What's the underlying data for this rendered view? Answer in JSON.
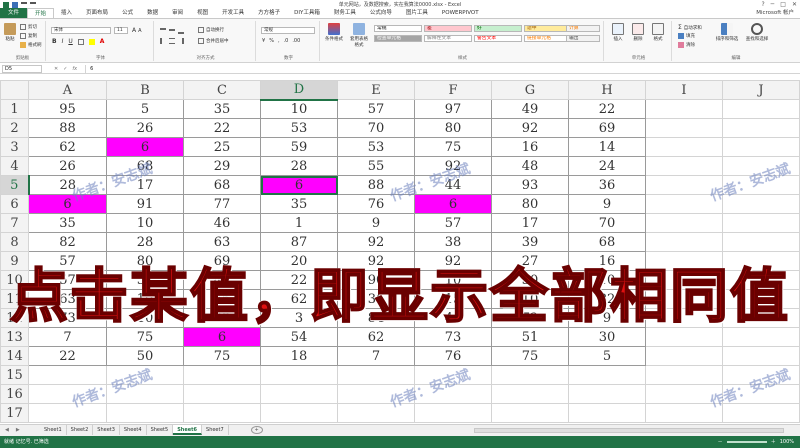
{
  "window": {
    "title": "单元网站，及数据搜索，实在我算法0000.xlsx - Excel",
    "user": "Microsoft 帐户"
  },
  "tabs": [
    "文件",
    "开始",
    "插入",
    "页面布局",
    "公式",
    "数据",
    "审阅",
    "视图",
    "开发工具",
    "方方格子",
    "DIY工具箱",
    "财务工具",
    "公式向导",
    "图片工具",
    "POWERPIVOT"
  ],
  "ribbon": {
    "clipboard_label": "剪贴板",
    "paste": "粘贴",
    "cut": "剪切",
    "copy": "复制",
    "format_painter": "格式刷",
    "font_label": "字体",
    "font_name": "宋体",
    "font_size": "11",
    "align_label": "对齐方式",
    "wrap": "自动换行",
    "merge": "合并后居中",
    "number_label": "数字",
    "number_format": "常规",
    "cond_format": "条件格式",
    "table_format": "套用表格格式",
    "styles_label": "样式",
    "style_cells": [
      {
        "text": "常规",
        "color": "#ffffff",
        "fg": "#000000"
      },
      {
        "text": "差",
        "color": "#ffc7ce",
        "fg": "#9c0006"
      },
      {
        "text": "好",
        "color": "#c6efce",
        "fg": "#006100"
      },
      {
        "text": "适中",
        "color": "#ffeb9c",
        "fg": "#9c5700"
      },
      {
        "text": "计算",
        "color": "#f2f2f2",
        "fg": "#fa7d00"
      },
      {
        "text": "检查单元格",
        "color": "#a5a5a5",
        "fg": "#ffffff"
      },
      {
        "text": "解释性文本",
        "color": "#ffffff",
        "fg": "#7f7f7f"
      },
      {
        "text": "警告文本",
        "color": "#ffffff",
        "fg": "#ff0000"
      },
      {
        "text": "链接单元格",
        "color": "#ffffff",
        "fg": "#fa7d00"
      },
      {
        "text": "输出",
        "color": "#f2f2f2",
        "fg": "#3f3f3f"
      }
    ],
    "cells_label": "单元格",
    "insert": "插入",
    "delete": "删除",
    "format": "格式",
    "editing_label": "编辑",
    "autosum": "自动求和",
    "fill": "填充",
    "clear": "清除",
    "sort_filter": "排序和筛选",
    "find_select": "查找和选择"
  },
  "formula_bar": {
    "name_box": "D5",
    "cancel": "✕",
    "enter": "✓",
    "fx": "fx",
    "value": "6"
  },
  "grid": {
    "columns": [
      "A",
      "B",
      "C",
      "D",
      "E",
      "F",
      "G",
      "H",
      "I",
      "J"
    ],
    "active_col": "D",
    "active_row": 5,
    "rows": [
      [
        95,
        5,
        35,
        10,
        57,
        97,
        49,
        22
      ],
      [
        88,
        26,
        22,
        53,
        70,
        80,
        92,
        69
      ],
      [
        62,
        6,
        25,
        59,
        53,
        75,
        16,
        14
      ],
      [
        26,
        68,
        29,
        28,
        55,
        92,
        48,
        24
      ],
      [
        28,
        17,
        68,
        6,
        88,
        44,
        93,
        36
      ],
      [
        6,
        91,
        77,
        35,
        76,
        6,
        80,
        9
      ],
      [
        35,
        10,
        46,
        1,
        9,
        57,
        17,
        70
      ],
      [
        82,
        28,
        63,
        87,
        92,
        38,
        39,
        68
      ],
      [
        57,
        80,
        69,
        20,
        92,
        92,
        27,
        16
      ],
      [
        57,
        51,
        45,
        22,
        90,
        10,
        30,
        10
      ],
      [
        63,
        19,
        66,
        62,
        36,
        15,
        10,
        82
      ],
      [
        73,
        10,
        53,
        3,
        84,
        44,
        72,
        9
      ],
      [
        7,
        75,
        6,
        54,
        62,
        73,
        51,
        30
      ],
      [
        22,
        50,
        75,
        18,
        7,
        76,
        75,
        5
      ]
    ],
    "row_count": 17,
    "highlight_value": 6,
    "highlight_color": "#ff00ff"
  },
  "overlay": {
    "banner": "点击某值，即显示全部相同值",
    "watermark": "作者：安志斌"
  },
  "sheets": [
    "Sheet1",
    "Sheet2",
    "Sheet3",
    "Sheet4",
    "Sheet5",
    "Sheet6",
    "Sheet7"
  ],
  "active_sheet": "Sheet6",
  "status": {
    "left": "就绪 记忆号. 已筛选",
    "zoom": "100%"
  },
  "colors": {
    "accent": "#217346",
    "banner_red": "#e01010"
  }
}
